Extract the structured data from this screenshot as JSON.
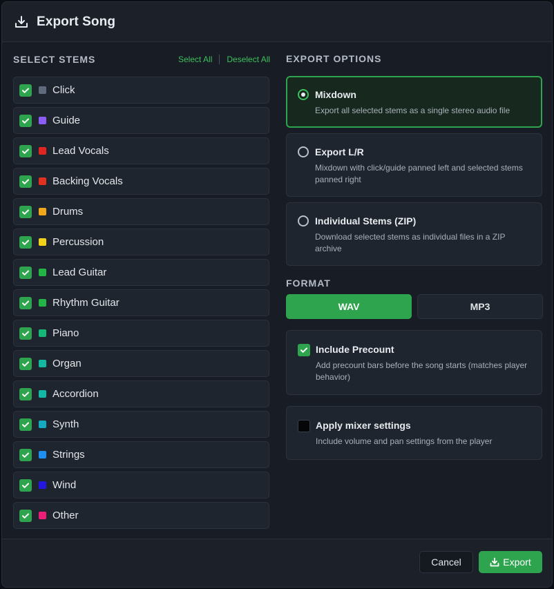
{
  "dialog": {
    "title": "Export Song",
    "title_icon": "download-icon"
  },
  "stems_section": {
    "label": "SELECT STEMS",
    "select_all": "Select All",
    "deselect_all": "Deselect All",
    "items": [
      {
        "name": "Click",
        "color": "#5f6b7d",
        "checked": true
      },
      {
        "name": "Guide",
        "color": "#8b5cf6",
        "checked": true
      },
      {
        "name": "Lead Vocals",
        "color": "#e0261e",
        "checked": true
      },
      {
        "name": "Backing Vocals",
        "color": "#e0321e",
        "checked": true
      },
      {
        "name": "Drums",
        "color": "#f0a81a",
        "checked": true
      },
      {
        "name": "Percussion",
        "color": "#f0d21a",
        "checked": true
      },
      {
        "name": "Lead Guitar",
        "color": "#22b545",
        "checked": true
      },
      {
        "name": "Rhythm Guitar",
        "color": "#22b545",
        "checked": true
      },
      {
        "name": "Piano",
        "color": "#15b877",
        "checked": true
      },
      {
        "name": "Organ",
        "color": "#14b8a0",
        "checked": true
      },
      {
        "name": "Accordion",
        "color": "#14b8a6",
        "checked": true
      },
      {
        "name": "Synth",
        "color": "#14a9c0",
        "checked": true
      },
      {
        "name": "Strings",
        "color": "#1e8ef0",
        "checked": true
      },
      {
        "name": "Wind",
        "color": "#2418e0",
        "checked": true
      },
      {
        "name": "Other",
        "color": "#ec1e78",
        "checked": true
      }
    ]
  },
  "export_options": {
    "label": "EXPORT OPTIONS",
    "options": [
      {
        "title": "Mixdown",
        "desc": "Export all selected stems as a single stereo audio file",
        "selected": true
      },
      {
        "title": "Export L/R",
        "desc": "Mixdown with click/guide panned left and selected stems panned right",
        "selected": false
      },
      {
        "title": "Individual Stems (ZIP)",
        "desc": "Download selected stems as individual files in a ZIP archive",
        "selected": false
      }
    ]
  },
  "format": {
    "label": "FORMAT",
    "options": [
      "WAV",
      "MP3"
    ],
    "selected": "WAV"
  },
  "include_precount": {
    "title": "Include Precount",
    "desc": "Add precount bars before the song starts (matches player behavior)",
    "checked": true
  },
  "apply_mixer": {
    "title": "Apply mixer settings",
    "desc": "Include volume and pan settings from the player",
    "checked": false
  },
  "footer": {
    "cancel": "Cancel",
    "export": "Export"
  },
  "colors": {
    "accent": "#2ea44f",
    "background": "#181d25"
  }
}
